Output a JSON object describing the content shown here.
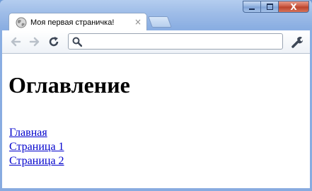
{
  "tab": {
    "title": "Моя первая страничка!",
    "icon": "globe-icon",
    "close": "×"
  },
  "toolbar": {
    "back_icon": "arrow-left-icon",
    "forward_icon": "arrow-right-icon",
    "reload_icon": "reload-icon",
    "wrench_icon": "wrench-icon",
    "address": {
      "value": "",
      "placeholder": ""
    }
  },
  "window_controls": {
    "close": "X"
  },
  "page": {
    "heading": "Оглавление",
    "links": [
      {
        "label": "Главная"
      },
      {
        "label": "Страница 1"
      },
      {
        "label": "Страница 2"
      }
    ]
  },
  "colors": {
    "link": "#0000cc",
    "frame": "#9fbde8"
  }
}
